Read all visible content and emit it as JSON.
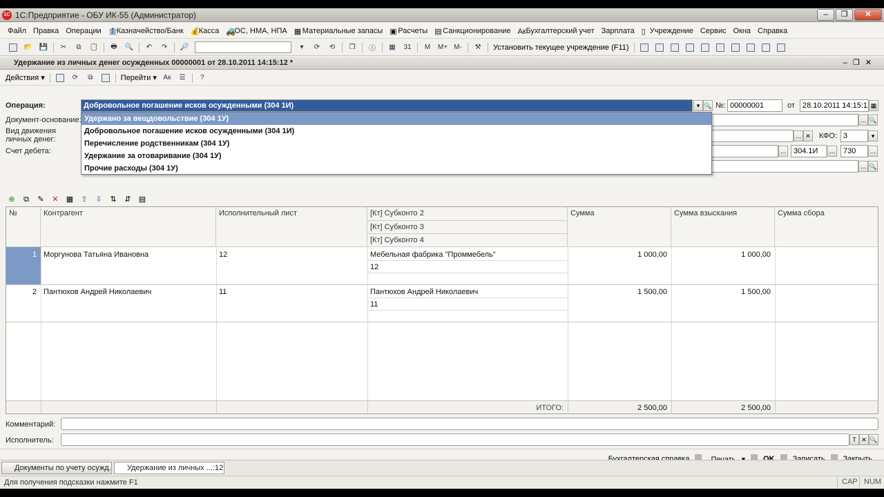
{
  "window": {
    "title": "1С:Предприятие - ОБУ ИК-55 (Администратор)",
    "icon": "1c-logo-icon"
  },
  "menu": [
    "Файл",
    "Правка",
    "Операции",
    "Казначейство/Банк",
    "Касса",
    "ОС, НМА, НПА",
    "Материальные запасы",
    "Расчеты",
    "Санкционирование",
    "Бухгалтерский учет",
    "Зарплата",
    "Учреждение",
    "Сервис",
    "Окна",
    "Справка"
  ],
  "toolbar": {
    "set_institution": "Установить текущее учреждение (F11)"
  },
  "document": {
    "title": "Удержание из личных денег осужденных 00000001 от 28.10.2011 14:15:12 *",
    "actions_label": "Действия",
    "goto_label": "Перейти",
    "operation_label": "Операция:",
    "operation_value": "Добровольное погашение исков осужденными (304 1И)",
    "number_label": "№:",
    "number_value": "00000001",
    "date_from_label": "от",
    "date_value": "28.10.2011 14:15:12",
    "basis_label": "Документ-основание:",
    "movement_label_1": "Вид движения",
    "movement_label_2": "личных денег:",
    "kfo_label": "КФО:",
    "kfo_value": "3",
    "debit_label": "Счет дебета:",
    "debit_account": "304.1И",
    "debit_code": "730",
    "comment_label": "Комментарий:",
    "executor_label": "Исполнитель:"
  },
  "dropdown": {
    "items": [
      "Удержано за вещдовольствие (304 1У)",
      "Добровольное погашение исков осужденными (304 1И)",
      "Перечисление родственникам (304 1У)",
      "Удержание за отоваривание (304 1У)",
      "Прочие расходы (304 1У)"
    ],
    "selected_index": 0
  },
  "table": {
    "headers": {
      "num": "№",
      "counterparty": "Контрагент",
      "writ": "Исполнительный лист",
      "sub2": "[Кт] Субконто 2",
      "sub3": "[Кт] Субконто 3",
      "sub4": "[Кт] Субконто 4",
      "sum": "Сумма",
      "sum_collect": "Сумма взыскания",
      "sum_fee": "Сумма сбора"
    },
    "rows": [
      {
        "num": "1",
        "counterparty": "Моргунова Татьяна Ивановна",
        "writ": "12",
        "sub2": "Мебельная фабрика \"Проммебель\"",
        "sub3": "12",
        "sum": "1 000,00",
        "sum_collect": "1 000,00"
      },
      {
        "num": "2",
        "counterparty": "Пантюхов Андрей Николаевич",
        "writ": "11",
        "sub2": "Пантюхов Андрей Николаевич",
        "sub3": "11",
        "sum": "1 500,00",
        "sum_collect": "1 500,00"
      }
    ],
    "total_label": "ИТОГО:",
    "total_sum": "2 500,00",
    "total_collect": "2 500,00"
  },
  "bottom_actions": {
    "reference": "Бухгалтерская справка",
    "print": "Печать",
    "ok": "OK",
    "save": "Записать",
    "close": "Закрыть"
  },
  "tasks": [
    "Документы по учету осужд...",
    "Удержание из личных ...:12 *"
  ],
  "status": {
    "hint": "Для получения подсказки нажмите F1",
    "cap": "CAP",
    "num": "NUM"
  }
}
